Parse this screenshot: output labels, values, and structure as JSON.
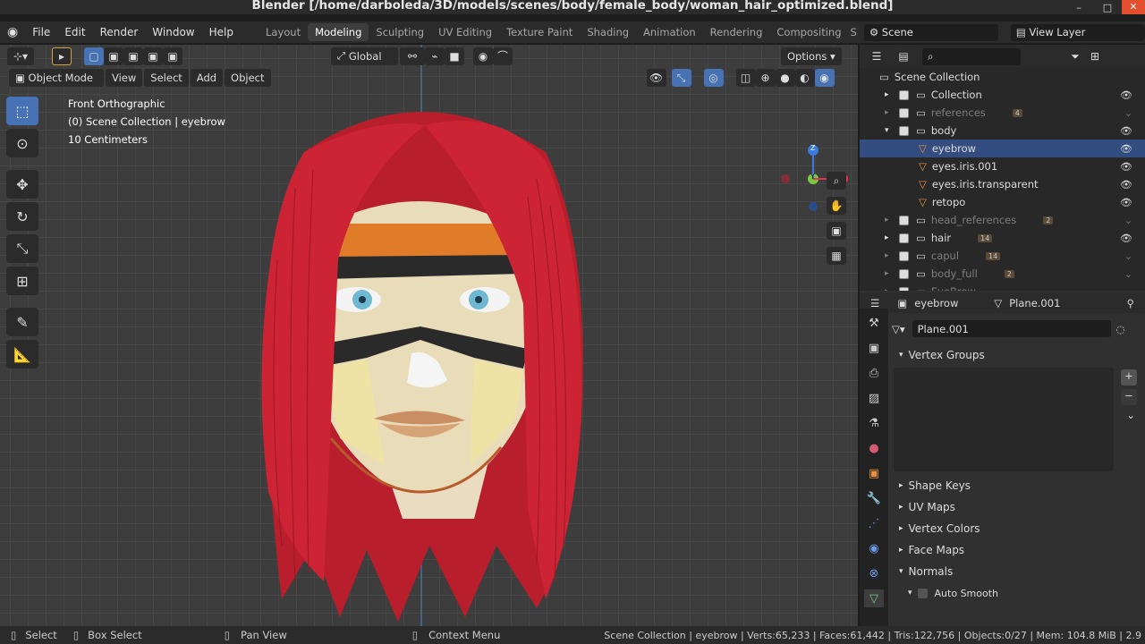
{
  "window": {
    "title": "Blender [/home/darboleda/3D/models/scenes/body/female_body/woman_hair_optimized.blend]",
    "controls": [
      "–",
      "□",
      "✕"
    ]
  },
  "menu": [
    "File",
    "Edit",
    "Render",
    "Window",
    "Help"
  ],
  "workspaces": [
    "Layout",
    "Modeling",
    "Sculpting",
    "UV Editing",
    "Texture Paint",
    "Shading",
    "Animation",
    "Rendering",
    "Compositing",
    "S"
  ],
  "active_workspace": "Modeling",
  "scene": "Scene",
  "view_layer": "View Layer",
  "viewport": {
    "mode": "Object Mode",
    "menus": [
      "View",
      "Select",
      "Add",
      "Object"
    ],
    "orientation": "Global",
    "options": "Options",
    "info": [
      "Front Orthographic",
      "(0) Scene Collection | eyebrow",
      "10 Centimeters"
    ],
    "gizmo": {
      "z": "Z",
      "y": "Y"
    }
  },
  "outliner": {
    "root": "Scene Collection",
    "rows": [
      {
        "name": "Collection",
        "level": 1,
        "dim": false,
        "selected": false,
        "badge": ""
      },
      {
        "name": "references",
        "level": 1,
        "dim": true,
        "selected": false,
        "badge": "4"
      },
      {
        "name": "body",
        "level": 1,
        "dim": false,
        "selected": false,
        "badge": ""
      },
      {
        "name": "eyebrow",
        "level": 2,
        "dim": false,
        "selected": true,
        "badge": ""
      },
      {
        "name": "eyes.iris.001",
        "level": 2,
        "dim": false,
        "selected": false,
        "badge": ""
      },
      {
        "name": "eyes.iris.transparent",
        "level": 2,
        "dim": false,
        "selected": false,
        "badge": ""
      },
      {
        "name": "retopo",
        "level": 2,
        "dim": false,
        "selected": false,
        "badge": ""
      },
      {
        "name": "head_references",
        "level": 1,
        "dim": true,
        "selected": false,
        "badge": "2"
      },
      {
        "name": "hair",
        "level": 1,
        "dim": false,
        "selected": false,
        "badge": "14"
      },
      {
        "name": "capul",
        "level": 1,
        "dim": true,
        "selected": false,
        "badge": "14"
      },
      {
        "name": "body_full",
        "level": 1,
        "dim": true,
        "selected": false,
        "badge": "2"
      },
      {
        "name": "EyeBrow",
        "level": 1,
        "dim": true,
        "selected": false,
        "badge": ""
      }
    ]
  },
  "properties": {
    "object": "eyebrow",
    "data": "Plane.001",
    "data_field": "Plane.001",
    "sections": [
      {
        "label": "Vertex Groups",
        "open": true
      },
      {
        "label": "Shape Keys",
        "open": false
      },
      {
        "label": "UV Maps",
        "open": false
      },
      {
        "label": "Vertex Colors",
        "open": false
      },
      {
        "label": "Face Maps",
        "open": false
      },
      {
        "label": "Normals",
        "open": true
      }
    ],
    "auto_smooth": "Auto Smooth"
  },
  "status": {
    "select": "Select",
    "box_select": "Box Select",
    "pan": "Pan View",
    "context": "Context Menu",
    "stats": "Scene Collection | eyebrow | Verts:65,233 | Faces:61,442 | Tris:122,756 | Objects:0/27 | Mem: 104.8 MiB | 2.9"
  }
}
